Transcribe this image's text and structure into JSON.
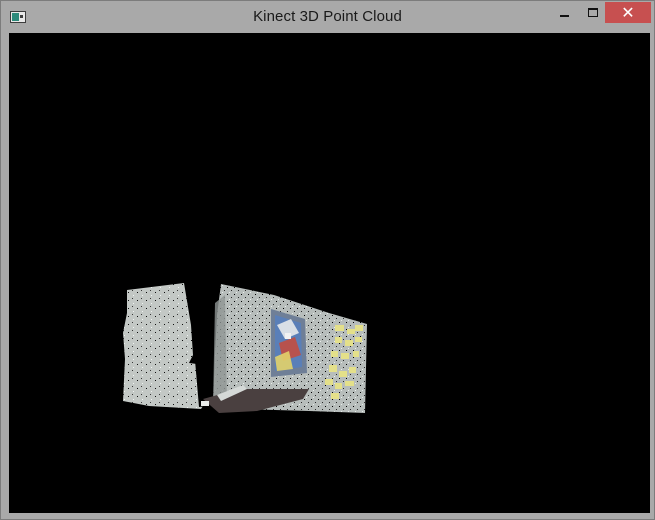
{
  "window": {
    "title": "Kinect 3D Point Cloud",
    "app_icon": "window-app-icon",
    "controls": {
      "minimize_icon": "minimize-icon",
      "maximize_icon": "maximize-icon",
      "close_symbol": "✕"
    }
  },
  "viewport": {
    "background": "#000000",
    "content": "point-cloud-render"
  },
  "colors": {
    "titlebar": "#a9a9a9",
    "close_button": "#c75050",
    "wall": "#b9c0bd",
    "poster": "#5e7fa4",
    "sticky_notes": "#e4e08a",
    "floor_object": "#4a4040"
  }
}
